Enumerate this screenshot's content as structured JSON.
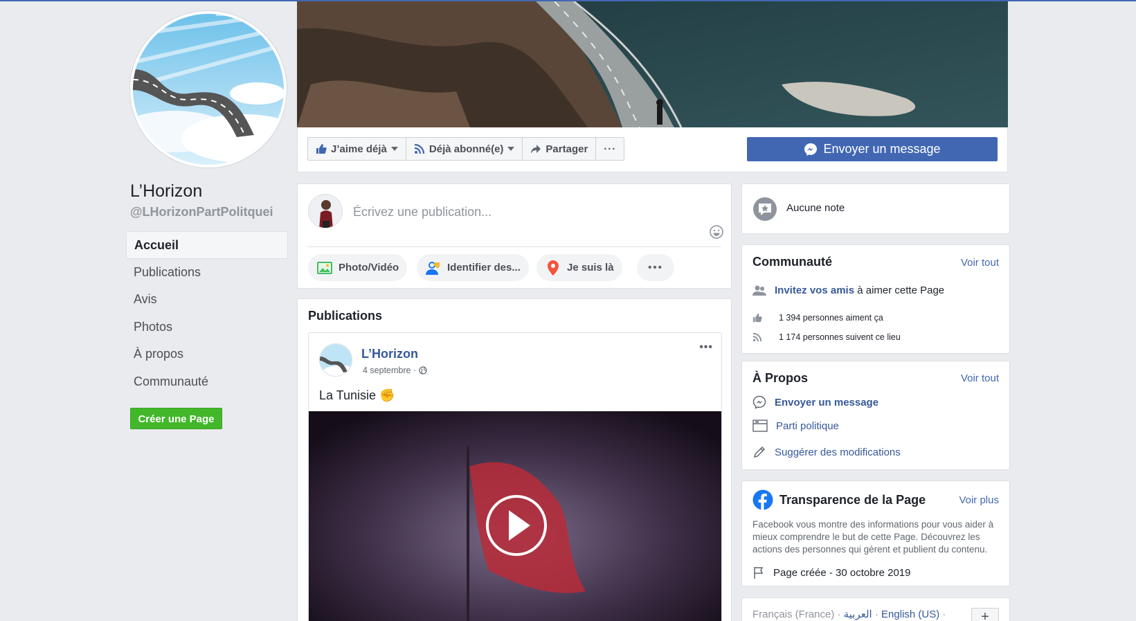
{
  "page": {
    "name": "L’Horizon",
    "handle": "@LHorizonPartPolitquei",
    "nav": [
      {
        "label": "Accueil",
        "active": true
      },
      {
        "label": "Publications",
        "active": false
      },
      {
        "label": "Avis",
        "active": false
      },
      {
        "label": "Photos",
        "active": false
      },
      {
        "label": "À propos",
        "active": false
      },
      {
        "label": "Communauté",
        "active": false
      }
    ],
    "create_page": "Créer une Page"
  },
  "actions": {
    "like": "J’aime déjà",
    "follow": "Déjà abonné(e)",
    "share": "Partager",
    "more": "···",
    "message": "Envoyer un message"
  },
  "composer": {
    "placeholder": "Écrivez une publication...",
    "photo": "Photo/Vidéo",
    "tag": "Identifier des...",
    "checkin": "Je suis là",
    "more": "•••"
  },
  "feed": {
    "title": "Publications",
    "post": {
      "author": "L’Horizon",
      "date": "4 septembre ·",
      "text": "La Tunisie ✊",
      "more": "•••"
    }
  },
  "right": {
    "notes": {
      "label": "Aucune note"
    },
    "community": {
      "title": "Communauté",
      "see_all": "Voir tout",
      "invite_link": "Invitez vos amis",
      "invite_rest": " à aimer cette Page",
      "likes": "1 394 personnes aiment ça",
      "follows": "1 174 personnes suivent ce lieu"
    },
    "about": {
      "title": "À Propos",
      "see_all": "Voir tout",
      "message": "Envoyer un message",
      "category": "Parti politique",
      "suggest": "Suggérer des modifications"
    },
    "transparency": {
      "title": "Transparence de la Page",
      "see_more": "Voir plus",
      "text": "Facebook vous montre des informations pour vous aider à mieux comprendre le but de cette Page. Découvrez les actions des personnes qui gèrent et publient du contenu.",
      "created": "Page créée - 30 octobre 2019"
    },
    "languages": {
      "lang1": "Français (France)",
      "dot1": " · ",
      "lang2": "العربية",
      "dot2": " · ",
      "lang3": "English (US)",
      "dot3": " ·",
      "plus": "+"
    }
  },
  "colors": {
    "brand": "#4267b2",
    "green": "#42b72a",
    "link": "#365899"
  }
}
